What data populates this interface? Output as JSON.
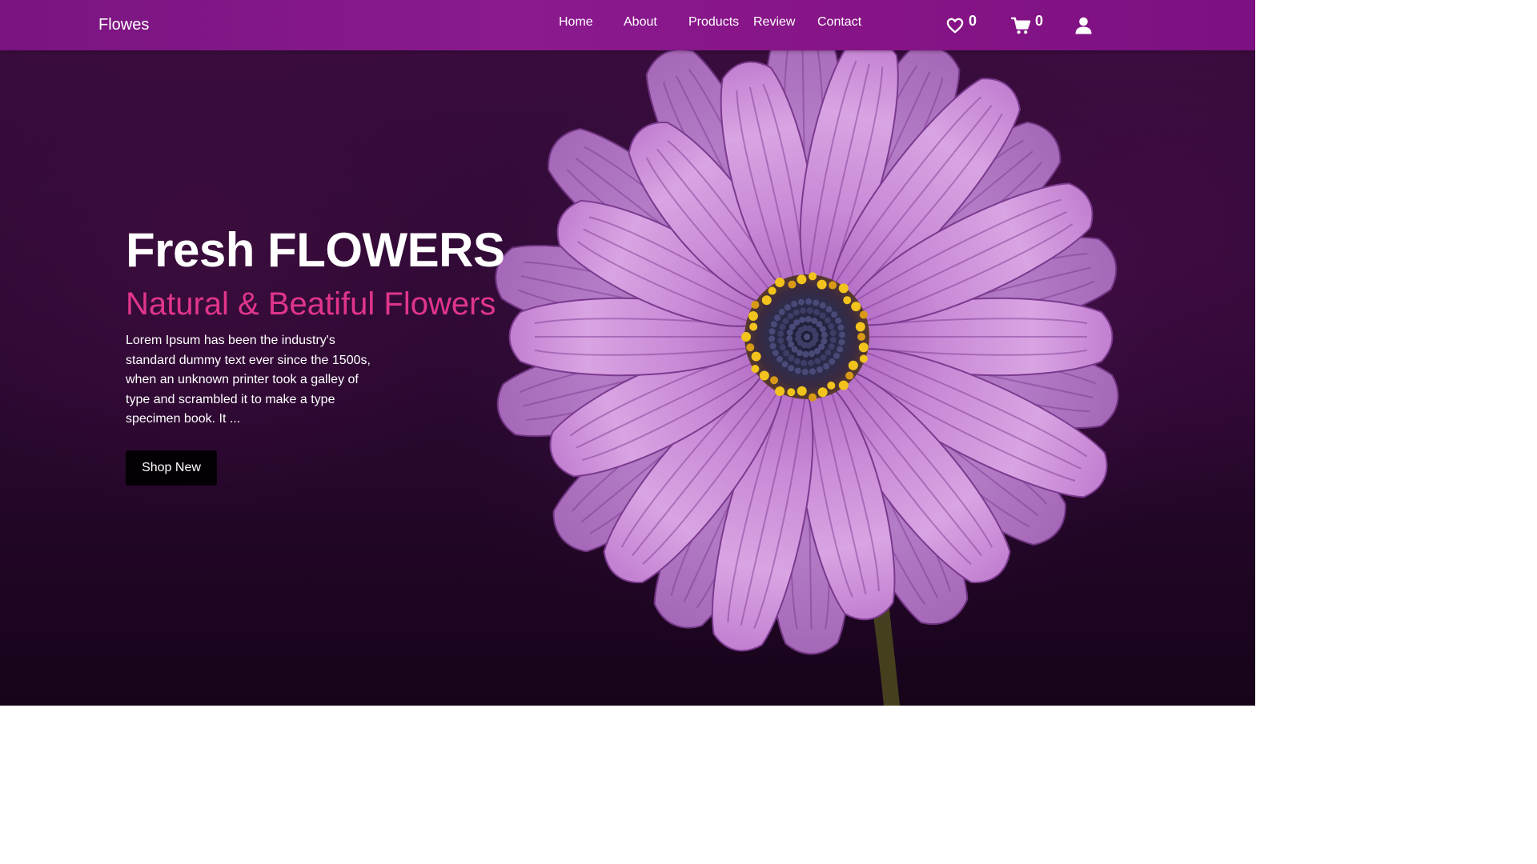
{
  "navbar": {
    "brand": "Flowes",
    "links": [
      "Home",
      "About",
      "Products",
      "Review",
      "Contact"
    ],
    "wishlist_count": "0",
    "cart_count": "0"
  },
  "hero": {
    "title": "Fresh FLOWERS",
    "subtitle": "Natural & Beatiful Flowers",
    "description": "Lorem Ipsum has been the industry's standard dummy text ever since the 1500s, when an unknown printer took a galley of type and scrambled it to make a type specimen book. It ...",
    "button_label": "Shop New"
  },
  "colors": {
    "navbar": "#861486",
    "accent_pink": "#e0358a",
    "button_bg": "#050005"
  },
  "icons": {
    "wishlist": "heart-icon",
    "cart": "cart-icon",
    "account": "user-icon"
  }
}
